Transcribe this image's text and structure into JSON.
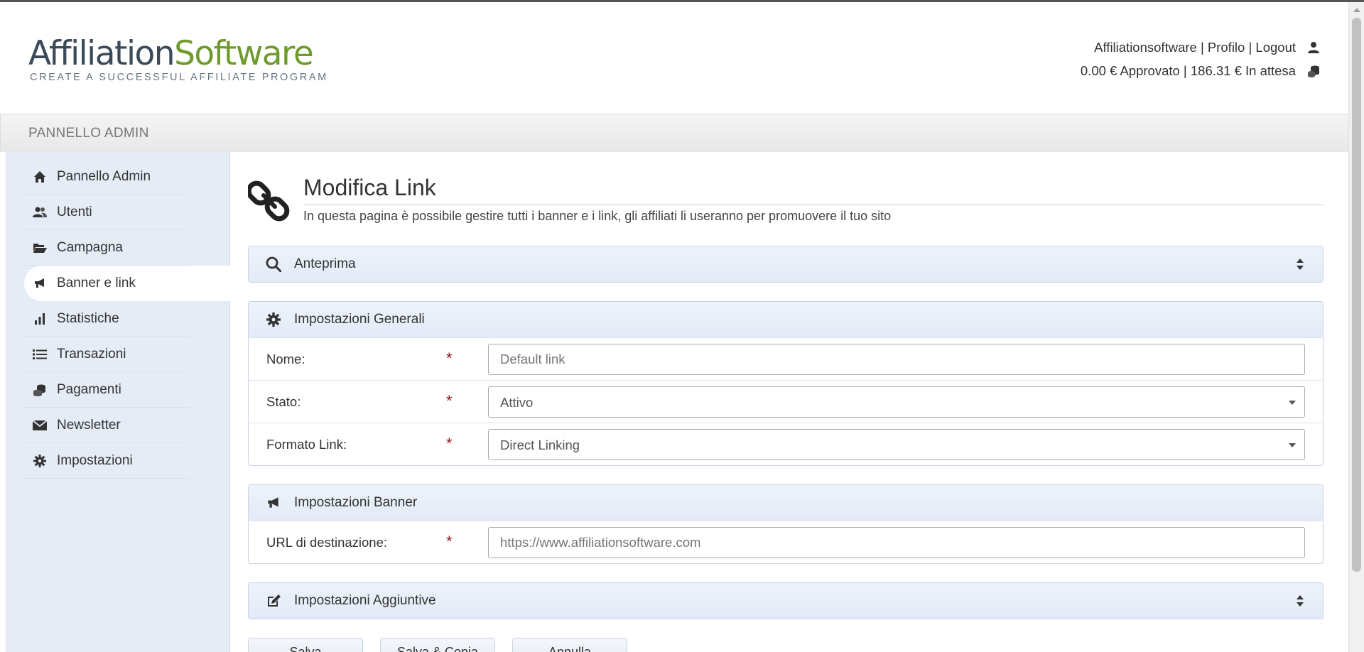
{
  "header": {
    "logo_part1": "Affiliation",
    "logo_part2": "Software",
    "logo_tagline": "CREATE A SUCCESSFUL AFFILIATE PROGRAM",
    "user_links": "Affiliationsoftware | Profilo | Logout",
    "balance": "0.00 € Approvato | 186.31 € In attesa"
  },
  "adminbar": {
    "title": "PANNELLO ADMIN"
  },
  "sidebar": {
    "items": [
      {
        "label": "Pannello Admin",
        "icon": "home-icon"
      },
      {
        "label": "Utenti",
        "icon": "users-icon"
      },
      {
        "label": "Campagna",
        "icon": "folder-open-icon"
      },
      {
        "label": "Banner e link",
        "icon": "bullhorn-icon",
        "active": true
      },
      {
        "label": "Statistiche",
        "icon": "bar-chart-icon"
      },
      {
        "label": "Transazioni",
        "icon": "list-icon"
      },
      {
        "label": "Pagamenti",
        "icon": "coins-icon"
      },
      {
        "label": "Newsletter",
        "icon": "envelope-icon"
      },
      {
        "label": "Impostazioni",
        "icon": "gear-icon"
      }
    ]
  },
  "page": {
    "title": "Modifica Link",
    "description": "In questa pagina è possibile gestire tutti i banner e i link, gli affiliati li useranno per promuovere il tuo sito"
  },
  "panels": {
    "preview": {
      "label": "Anteprima"
    },
    "general": {
      "label": "Impostazioni Generali",
      "name_label": "Nome:",
      "name_placeholder": "Default link",
      "status_label": "Stato:",
      "status_value": "Attivo",
      "format_label": "Formato Link:",
      "format_value": "Direct Linking"
    },
    "banner": {
      "label": "Impostazioni Banner",
      "url_label": "URL di destinazione:",
      "url_placeholder": "https://www.affiliationsoftware.com"
    },
    "additional": {
      "label": "Impostazioni Aggiuntive"
    },
    "required_mark": "*"
  },
  "buttons": {
    "save": "Salva",
    "save_copy": "Salva & Copia",
    "cancel": "Annulla"
  },
  "colors": {
    "logo_dark": "#3b4a58",
    "logo_green": "#6f9a2e",
    "sidebar_bg": "#e6ecf6",
    "required": "#8a1a1a"
  }
}
